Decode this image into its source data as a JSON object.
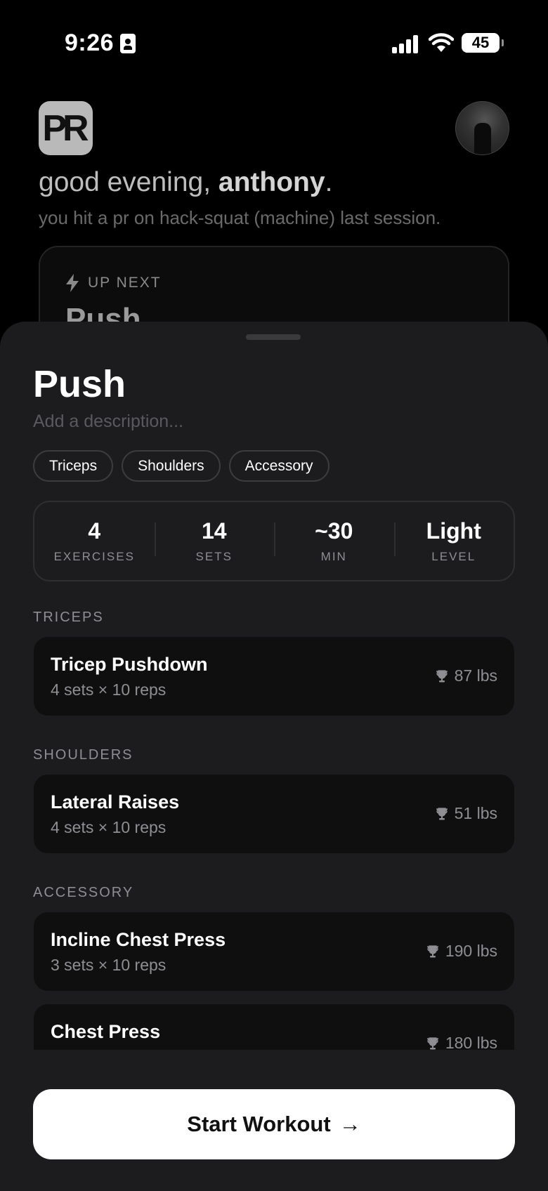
{
  "status_bar": {
    "time": "9:26",
    "battery": "45"
  },
  "header": {
    "logo": "PR",
    "greeting_prefix": "good evening, ",
    "user_name": "anthony",
    "greeting_suffix": ".",
    "subtitle": "you hit a pr on hack-squat (machine) last session."
  },
  "up_next": {
    "label": "UP NEXT",
    "title": "Push"
  },
  "workout": {
    "title": "Push",
    "description_placeholder": "Add a description...",
    "tags": [
      "Triceps",
      "Shoulders",
      "Accessory"
    ],
    "stats": [
      {
        "value": "4",
        "label": "EXERCISES"
      },
      {
        "value": "14",
        "label": "SETS"
      },
      {
        "value": "~30",
        "label": "MIN"
      },
      {
        "value": "Light",
        "label": "LEVEL"
      }
    ],
    "sections": [
      {
        "label": "TRICEPS",
        "exercises": [
          {
            "name": "Tricep Pushdown",
            "sets": "4 sets × 10 reps",
            "pr": "87 lbs"
          }
        ]
      },
      {
        "label": "SHOULDERS",
        "exercises": [
          {
            "name": "Lateral Raises",
            "sets": "4 sets × 10 reps",
            "pr": "51 lbs"
          }
        ]
      },
      {
        "label": "ACCESSORY",
        "exercises": [
          {
            "name": "Incline Chest Press",
            "sets": "3 sets × 10 reps",
            "pr": "190 lbs"
          },
          {
            "name": "Chest Press",
            "sets": "",
            "pr": "180 lbs"
          }
        ]
      }
    ],
    "start_button": "Start Workout",
    "start_arrow": "→"
  }
}
